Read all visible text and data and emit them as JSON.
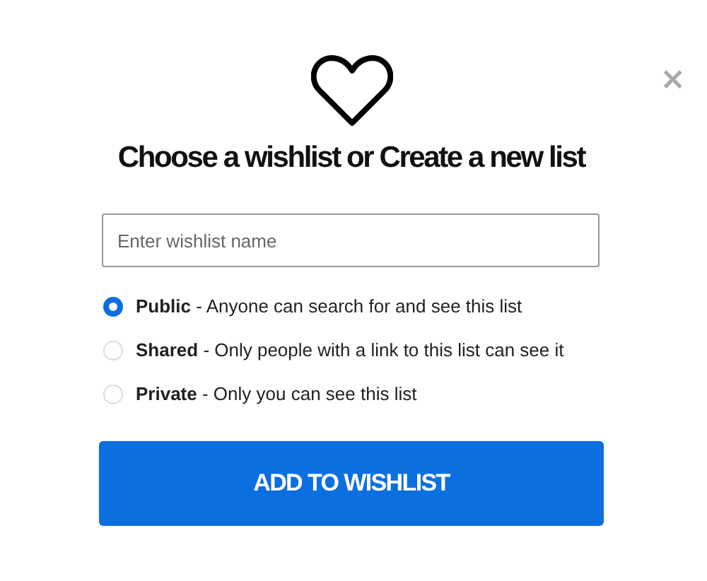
{
  "close_button": "×",
  "title": "Choose a wishlist or Create a new list",
  "name_field": {
    "placeholder": "Enter wishlist name"
  },
  "privacy_options": [
    {
      "label": "**Public** - Anyone can search for and see this list",
      "selected": true
    },
    {
      "label": "**Shared** - Only people with a link to this list can see it",
      "selected": false
    },
    {
      "label": "**Private** - Only you can see this list",
      "selected": false
    }
  ],
  "submit_button": "ADD TO WISHLIST"
}
